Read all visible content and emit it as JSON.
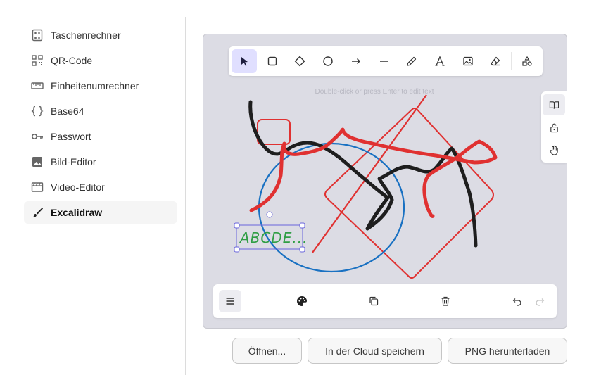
{
  "sidebar": {
    "items": [
      {
        "label": "Taschenrechner",
        "icon": "calculator-icon"
      },
      {
        "label": "QR-Code",
        "icon": "qr-code-icon"
      },
      {
        "label": "Einheitenumrechner",
        "icon": "ruler-icon"
      },
      {
        "label": "Base64",
        "icon": "braces-icon"
      },
      {
        "label": "Passwort",
        "icon": "key-icon"
      },
      {
        "label": "Bild-Editor",
        "icon": "image-icon"
      },
      {
        "label": "Video-Editor",
        "icon": "film-icon"
      },
      {
        "label": "Excalidraw",
        "icon": "brush-icon",
        "active": true
      }
    ]
  },
  "canvas": {
    "hint": "Double-click or press Enter to edit text",
    "text_element": "ABCDE...",
    "colors": {
      "black_stroke": "#1e1e1e",
      "red_stroke": "#e03131",
      "blue_stroke": "#1971c2",
      "green_text": "#2f9e44",
      "selection": "#6965db",
      "canvas_bg": "#dcdce4"
    }
  },
  "toolbar": {
    "tools": [
      "selection-icon",
      "rectangle-icon",
      "diamond-icon",
      "ellipse-icon",
      "arrow-icon",
      "line-icon",
      "pencil-icon",
      "text-icon",
      "image-icon",
      "eraser-icon",
      "shapes-library-icon"
    ],
    "active_tool": "selection-icon"
  },
  "side_tools": [
    "library-icon",
    "unlock-icon",
    "hand-icon"
  ],
  "bottom_bar": [
    "menu-icon",
    "palette-icon",
    "duplicate-icon",
    "trash-icon",
    "undo-icon",
    "redo-icon"
  ],
  "actions": {
    "open": "Öffnen...",
    "save_cloud": "In der Cloud speichern",
    "download_png": "PNG herunterladen"
  }
}
